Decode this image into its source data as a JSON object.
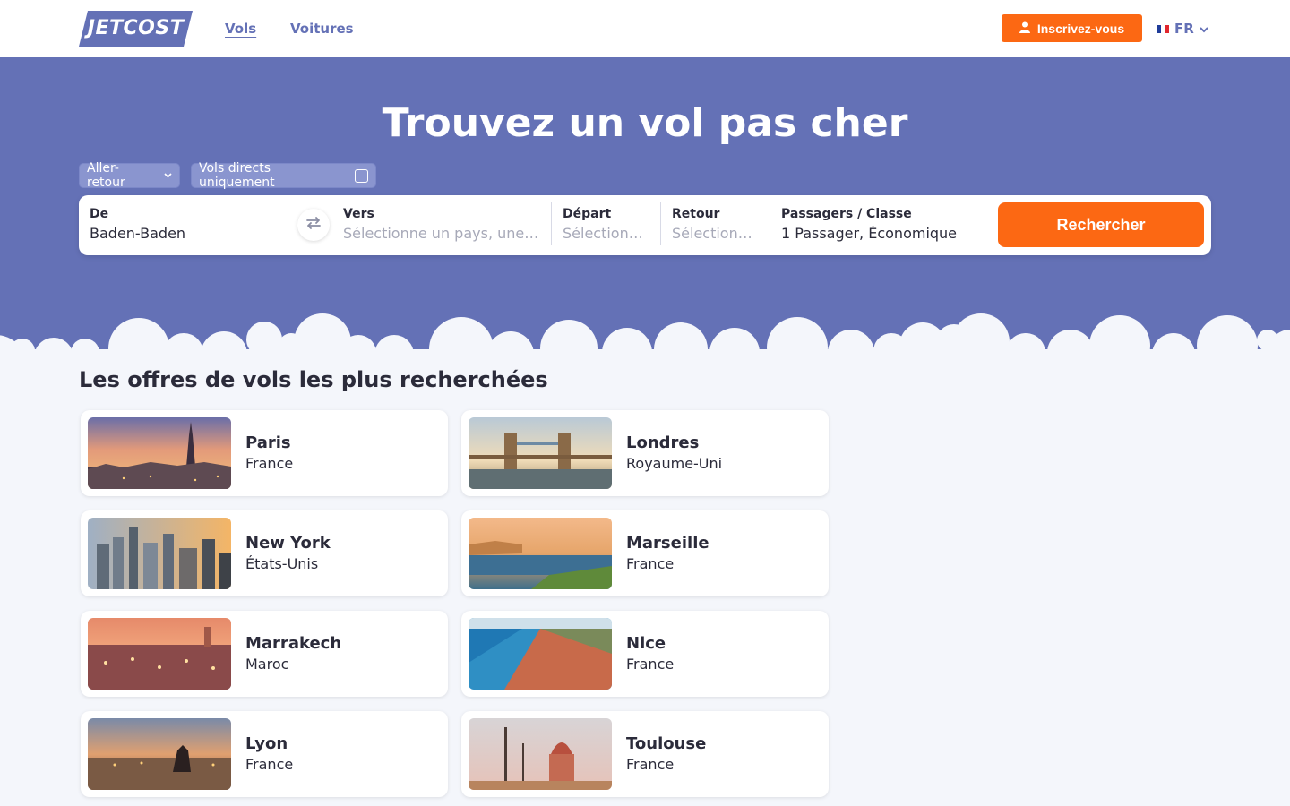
{
  "header": {
    "logo_text": "JETCOST",
    "nav": [
      {
        "label": "Vols",
        "active": true
      },
      {
        "label": "Voitures",
        "active": false
      }
    ],
    "signup_label": "Inscrivez-vous",
    "lang_label": "FR",
    "brand_color": "#6471b6",
    "accent_color": "#fc6813"
  },
  "hero": {
    "title": "Trouvez un vol pas cher",
    "trip_type": "Aller-retour",
    "direct_label": "Vols directs uniquement",
    "direct_checked": false,
    "search": {
      "from_label": "De",
      "from_value": "Baden-Baden",
      "to_label": "Vers",
      "to_placeholder": "Sélectionne un pays, une…",
      "depart_label": "Départ",
      "depart_placeholder": "Sélection…",
      "return_label": "Retour",
      "return_placeholder": "Sélection…",
      "passengers_label": "Passagers / Classe",
      "passengers_value": "1 Passager, Économique",
      "button_label": "Rechercher"
    }
  },
  "offers": {
    "title": "Les offres de vols les plus recherchées",
    "items": [
      {
        "city": "Paris",
        "country": "France",
        "image": "eiffel-tower-sunset"
      },
      {
        "city": "Londres",
        "country": "Royaume-Uni",
        "image": "tower-bridge"
      },
      {
        "city": "New York",
        "country": "États-Unis",
        "image": "manhattan-skyline"
      },
      {
        "city": "Marseille",
        "country": "France",
        "image": "marseille-harbour"
      },
      {
        "city": "Marrakech",
        "country": "Maroc",
        "image": "jemaa-el-fna-dusk"
      },
      {
        "city": "Nice",
        "country": "France",
        "image": "promenade-des-anglais"
      },
      {
        "city": "Lyon",
        "country": "France",
        "image": "place-bellecour"
      },
      {
        "city": "Toulouse",
        "country": "France",
        "image": "dome-de-la-grave"
      }
    ]
  }
}
